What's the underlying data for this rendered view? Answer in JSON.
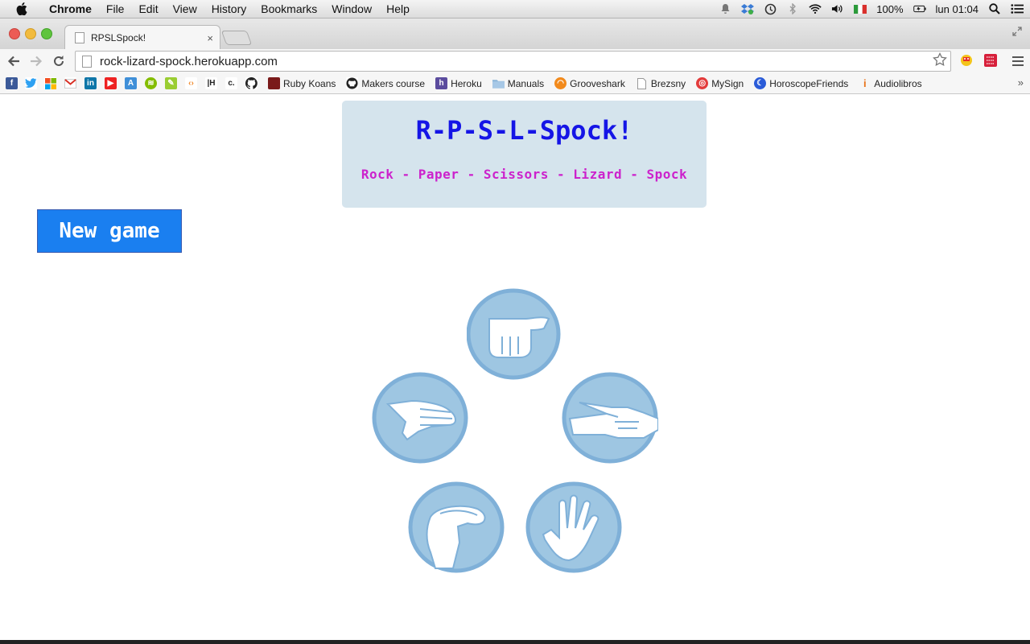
{
  "menubar": {
    "app": "Chrome",
    "items": [
      "File",
      "Edit",
      "View",
      "History",
      "Bookmarks",
      "Window",
      "Help"
    ],
    "battery": "100%",
    "clock": "lun 01:04"
  },
  "tab": {
    "title": "RPSLSpock!",
    "close": "×"
  },
  "omnibox": {
    "url": "rock-lizard-spock.herokuapp.com"
  },
  "bookmarks": [
    {
      "label": "Ruby Koans",
      "icon": "ruby-koans-icon",
      "color": "#7a1a1a"
    },
    {
      "label": "Makers course",
      "icon": "github-icon",
      "color": "#222222"
    },
    {
      "label": "Heroku",
      "icon": "heroku-icon",
      "color": "#5b4c9e"
    },
    {
      "label": "Manuals",
      "icon": "folder-icon",
      "color": "#8ab4d8"
    },
    {
      "label": "Grooveshark",
      "icon": "grooveshark-icon",
      "color": "#f28a1c"
    },
    {
      "label": "Brezsny",
      "icon": "page-icon",
      "color": "#ffffff"
    },
    {
      "label": "MySign",
      "icon": "mysign-icon",
      "color": "#e33b3b"
    },
    {
      "label": "HoroscopeFriends",
      "icon": "moon-icon",
      "color": "#2a5bd8"
    },
    {
      "label": "Audiolibros",
      "icon": "info-icon",
      "color": "#e8731a"
    }
  ],
  "page": {
    "title": "R-P-S-L-Spock!",
    "subtitle": "Rock - Paper - Scissors - Lizard - Spock",
    "new_game": "New game",
    "choices": [
      "rock",
      "paper",
      "scissors",
      "lizard",
      "spock"
    ]
  },
  "colors": {
    "header_bg": "#d5e4ed",
    "title": "#1515e6",
    "subtitle": "#cc22cc",
    "button": "#1a7ff0",
    "hand_circle": "#9ec6e2",
    "hand_ring": "#7fb0d8"
  }
}
